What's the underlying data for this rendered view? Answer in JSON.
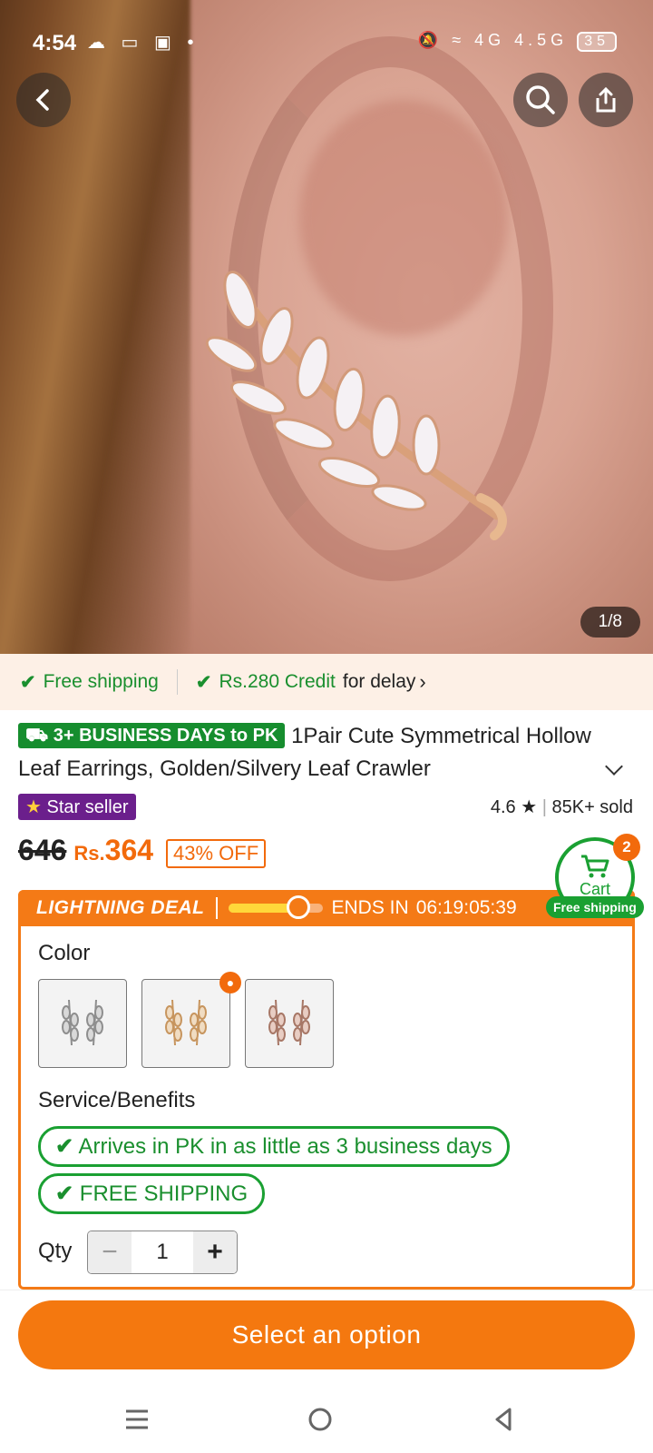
{
  "status_bar": {
    "time": "4:54",
    "left_icons": "☁ ▭ ▣ •",
    "right_icons": "4G 4.5G",
    "battery": "35"
  },
  "gallery": {
    "page_indicator": "1/8"
  },
  "promo_strip": {
    "free_shipping": "Free shipping",
    "credit": "Rs.280 Credit",
    "credit_suffix": "for delay"
  },
  "product": {
    "shipping_badge": "3+ BUSINESS DAYS to PK",
    "title": "1Pair Cute Symmetrical Hollow Leaf Earrings, Golden/Silvery Leaf Crawler",
    "seller_badge": "Star seller",
    "rating": "4.6",
    "sold": "85K+ sold",
    "old_price": "646",
    "currency": "Rs.",
    "price": "364",
    "discount": "43% OFF"
  },
  "cart": {
    "label": "Cart",
    "count": "2",
    "free_shipping": "Free shipping"
  },
  "deal": {
    "title": "LIGHTNING DEAL",
    "ends_label": "ENDS IN",
    "countdown": "06:19:05:39",
    "progress": 0.75
  },
  "options": {
    "color_label": "Color",
    "swatches": [
      "silver",
      "gold",
      "rose-gold"
    ],
    "service_label": "Service/Benefits",
    "benefits": [
      "Arrives in PK in as little as 3 business days",
      "FREE SHIPPING"
    ],
    "qty_label": "Qty",
    "qty_value": "1"
  },
  "cta": {
    "label": "Select an option"
  },
  "colors": {
    "accent": "#f4780f",
    "green": "#1a8f2e",
    "seller_purple": "#6b1f8c"
  }
}
